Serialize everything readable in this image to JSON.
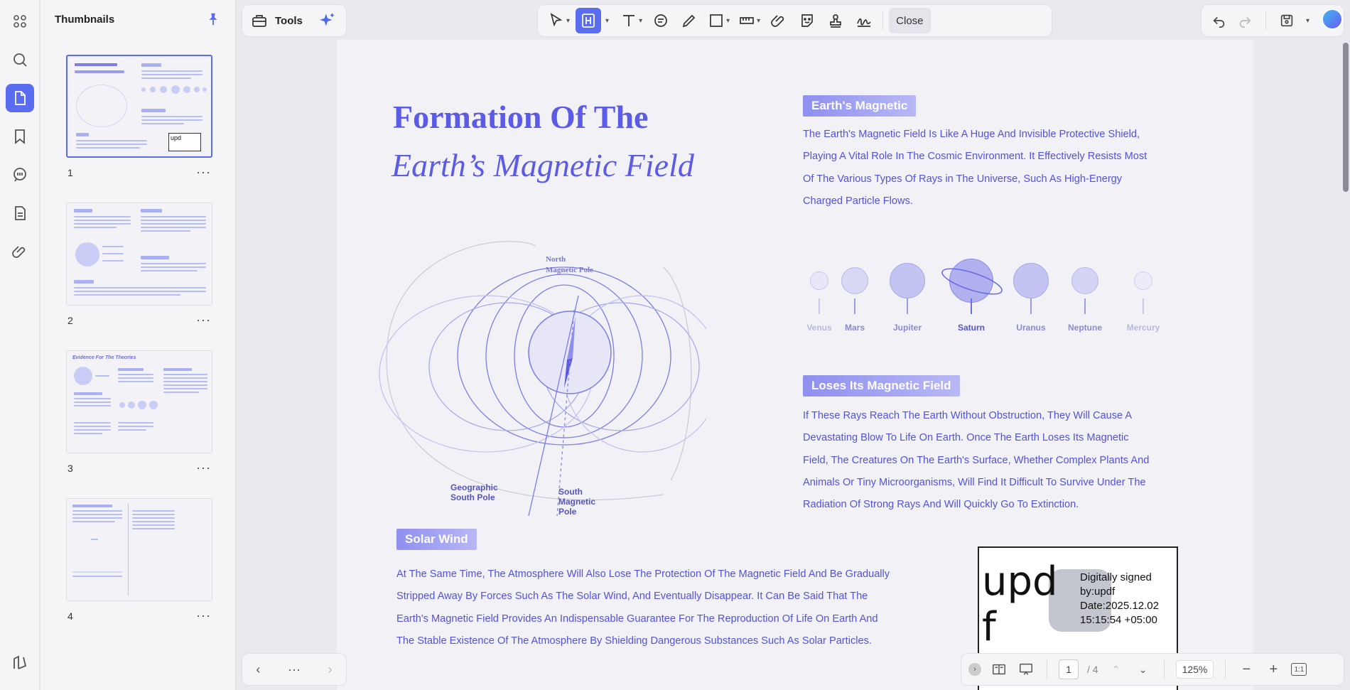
{
  "sidebar_panel": {
    "title": "Thumbnails"
  },
  "thumbnails": [
    {
      "page": "1",
      "more": "···"
    },
    {
      "page": "2",
      "more": "···"
    },
    {
      "page": "3",
      "more": "···"
    },
    {
      "page": "4",
      "more": "···"
    }
  ],
  "thumb3_heading": "Evidence For The Theories",
  "toolbar": {
    "tools_label": "Tools",
    "close_label": "Close"
  },
  "document": {
    "title_line1": "Formation Of The",
    "title_line2": "Earth’s Magnetic Field",
    "section1": {
      "heading": "Earth's Magnetic",
      "lines": [
        "The Earth's Magnetic Field Is Like A Huge And Invisible Protective Shield,",
        "Playing A Vital Role In The Cosmic Environment. It Effectively Resists Most",
        "Of The Various Types Of Rays in The Universe, Such As High-Energy",
        "Charged Particle Flows."
      ]
    },
    "section2": {
      "heading": "Loses Its Magnetic Field",
      "lines": [
        "If These Rays Reach The Earth Without Obstruction, They Will Cause A",
        "Devastating Blow To Life On Earth. Once The Earth Loses Its Magnetic",
        "Field, The Creatures On The Earth's Surface, Whether Complex Plants And",
        "Animals Or Tiny Microorganisms, Will Find It Difficult To Survive Under The",
        "Radiation Of Strong Rays And Will Quickly Go To Extinction."
      ]
    },
    "section3": {
      "heading": "Solar Wind",
      "lines": [
        "At The Same Time, The Atmosphere Will Also Lose The Protection Of The Magnetic Field And Be Gradually",
        "Stripped Away By Forces Such As The Solar Wind, And Eventually Disappear. It Can Be Said That The",
        "Earth's Magnetic Field Provides An Indispensable Guarantee For The Reproduction Of Life On Earth And",
        "The Stable Existence Of The Atmosphere By Shielding Dangerous Substances Such As Solar Particles."
      ]
    },
    "diagram": {
      "north_label_1": "North",
      "north_label_2": "Magnetic Pole",
      "geo_south_1": "Geographic",
      "geo_south_2": "South Pole",
      "south_mag_1": "South",
      "south_mag_2": "Magnetic",
      "south_mag_3": "Pole"
    },
    "planets": [
      "Venus",
      "Mars",
      "Jupiter",
      "Saturn",
      "Uranus",
      "Neptune",
      "Mercury"
    ],
    "signature": {
      "logo_line1": "upd",
      "logo_line2": "f",
      "text_line1": "Digitally signed",
      "text_line2": "by:updf",
      "text_line3": "Date:2025.12.02",
      "text_line4": "15:15:54 +05:00"
    }
  },
  "pager": {
    "current": "1",
    "total": "/ 4",
    "zoom": "125%",
    "more": "···"
  },
  "colors": {
    "accent": "#5a6cf0",
    "doc_text": "#5252dd",
    "title": "#5b5be6"
  }
}
